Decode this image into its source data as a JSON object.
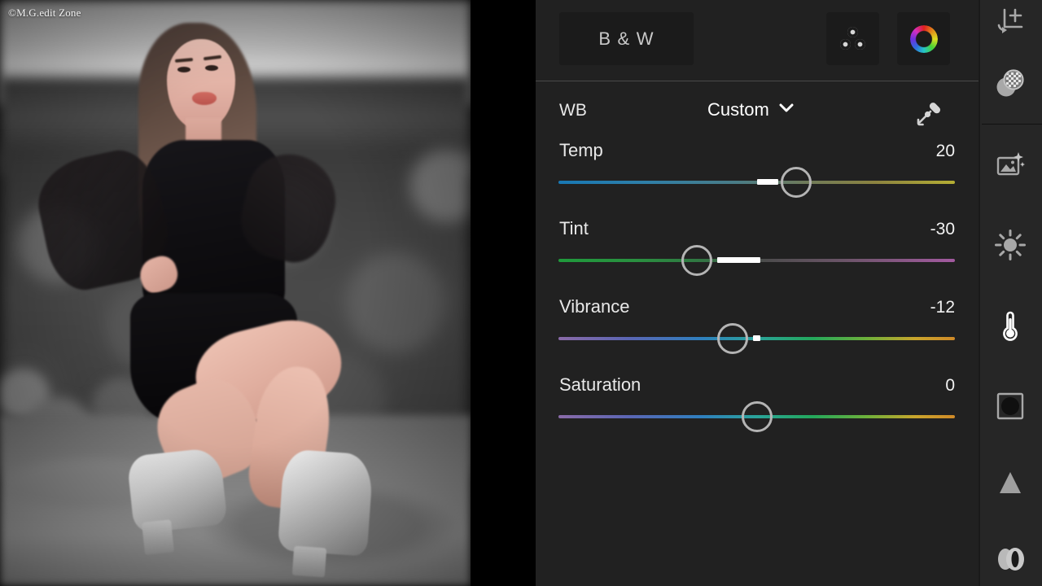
{
  "photo": {
    "watermark": "©M.G.edit Zone",
    "alt_description": "Black and white portrait of a woman crouching outdoors wearing a dark dress and silver ankle boots"
  },
  "overflow_menu": {
    "name": "three-dot-menu",
    "dots": 3
  },
  "panel": {
    "header": {
      "bw_button": "B & W",
      "mix_button_icon": "color-mix-icon",
      "hsl_button_icon": "color-wheel-icon"
    },
    "white_balance": {
      "label": "WB",
      "value": "Custom",
      "chevron_icon": "chevron-down-icon",
      "eyedropper_icon": "eyedropper-icon"
    },
    "sliders": [
      {
        "name": "Temp",
        "value": "20",
        "knob_pct": 60,
        "fill_from_pct": 50,
        "fill_to_pct": 55.5,
        "gradient": "linear-gradient(90deg,#1878b4 0%,#2f7fa8 22%,#4a7c86 45%,#6e7a5a 62%,#8c8340 80%,#b5ae34 100%)"
      },
      {
        "name": "Tint",
        "value": "-30",
        "knob_pct": 35,
        "fill_from_pct": 40,
        "fill_to_pct": 51,
        "gradient": "linear-gradient(90deg,#1f9a3c 0%,#2a8f40 20%,#2f7a42 34%,#4c4c4c 52%,#6b5468 72%,#a35aa0 100%)"
      },
      {
        "name": "Vibrance",
        "value": "-12",
        "knob_pct": 44,
        "fill_from_pct": 49,
        "fill_to_pct": 51,
        "gradient": "linear-gradient(90deg,#8a6aa8 0%,#5a66b4 18%,#2f7fbe 36%,#2aa39a 50%,#23a85c 64%,#6fb13a 78%,#c9a52c 90%,#d08a28 100%)"
      },
      {
        "name": "Saturation",
        "value": "0",
        "knob_pct": 50,
        "fill_from_pct": 50,
        "fill_to_pct": 50,
        "gradient": "linear-gradient(90deg,#8a6aa8 0%,#5a66b4 18%,#2f7fbe 36%,#2aa39a 50%,#23a85c 64%,#6fb13a 78%,#c9a52c 90%,#d08a28 100%)"
      }
    ]
  },
  "toolbar": {
    "items": [
      {
        "icon": "crop-rotate-icon",
        "active": false
      },
      {
        "icon": "healing-blend-icon",
        "active": false
      },
      {
        "icon": "magic-photo-icon",
        "active": false
      },
      {
        "icon": "light-sun-icon",
        "active": false
      },
      {
        "icon": "color-thermometer-icon",
        "active": true
      },
      {
        "icon": "effects-vignette-icon",
        "active": false
      },
      {
        "icon": "detail-triangle-icon",
        "active": false
      },
      {
        "icon": "optics-lens-icon",
        "active": false
      }
    ]
  },
  "colors": {
    "panel_bg": "#212121",
    "rail_bg": "#262626",
    "button_bg": "#1b1b1b",
    "accent_text": "#ffffff",
    "divider": "#4a4a4a",
    "knob_stroke": "#b4b4b4"
  }
}
